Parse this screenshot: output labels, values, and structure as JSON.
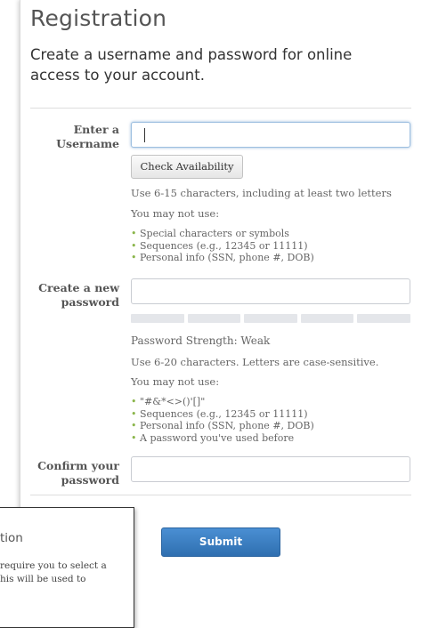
{
  "page": {
    "title": "Registration",
    "subtitle": "Create a username and password for online access to your account."
  },
  "username": {
    "label_line1": "Enter a",
    "label_line2": "Username",
    "value": "",
    "check_button": "Check Availability",
    "hint": "Use 6-15 characters, including at least two letters",
    "not_use_heading": "You may not use:",
    "rules": [
      "Special characters or symbols",
      "Sequences (e.g., 12345 or 11111)",
      "Personal info (SSN, phone #, DOB)"
    ]
  },
  "password": {
    "label_line1": "Create a new",
    "label_line2": "password",
    "strength_text": "Password Strength: Weak",
    "strength_level": 0,
    "hint": "Use 6-20 characters. Letters are case-sensitive.",
    "not_use_heading": "You may not use:",
    "rules": [
      "\"#&*<>()'[]\"",
      "Sequences (e.g., 12345 or 11111)",
      "Personal info (SSN, phone #, DOB)",
      "A password you've used before"
    ]
  },
  "confirm": {
    "label_line1": "Confirm your",
    "label_line2": "password"
  },
  "submit_label": "Submit",
  "popup": {
    "title": "tion",
    "line1": "require you to select a",
    "line2": "his will be used to"
  },
  "colors": {
    "accent": "#3b7fc4",
    "bullet": "#8ab54a"
  }
}
